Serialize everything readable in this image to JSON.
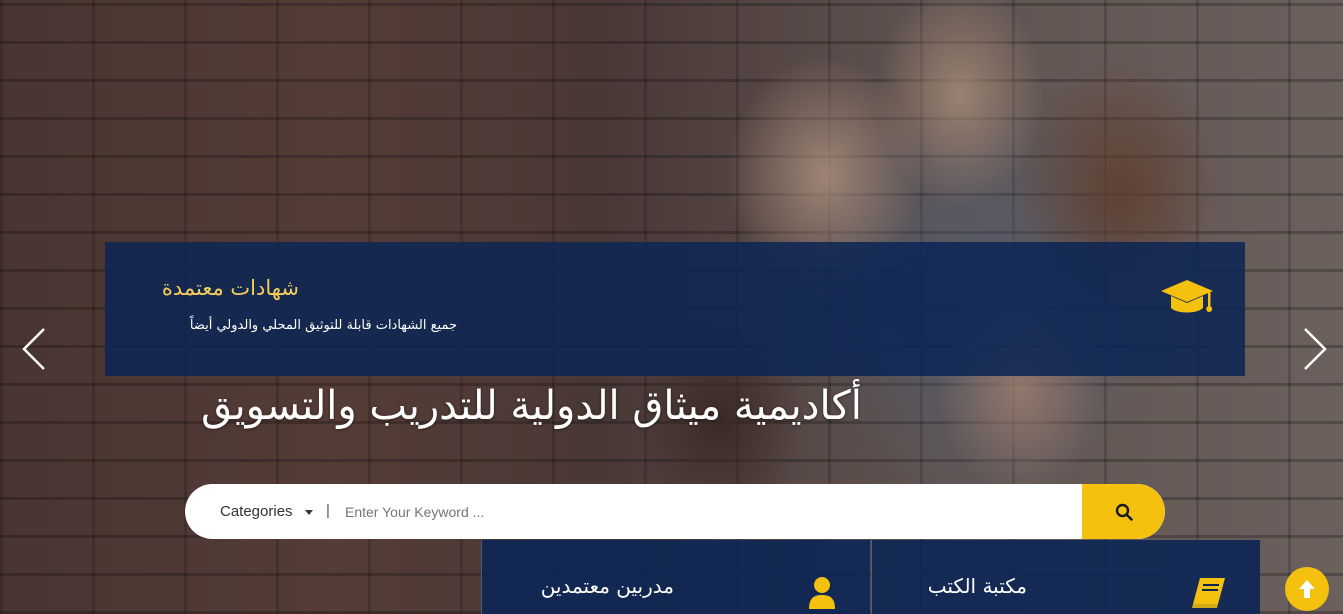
{
  "slider": {
    "caption_title": "شهادات معتمدة",
    "caption_text": "جميع الشهادات قابلة للتوثيق المحلي والدولي أيضاً",
    "caption_icon": "graduation-cap-icon",
    "prev_icon": "chevron-left-icon",
    "next_icon": "chevron-right-icon"
  },
  "headline": "أكاديمية ميثاق الدولية للتدريب والتسويق",
  "search": {
    "category_label": "Categories",
    "separator": "|",
    "keyword_placeholder": "Enter Your Keyword ...",
    "keyword_value": "",
    "button_icon": "search-icon"
  },
  "features": [
    {
      "title": "مدربين معتمدين",
      "icon": "user-icon"
    },
    {
      "title": "مكتبة الكتب",
      "icon": "book-icon"
    }
  ],
  "colors": {
    "accent": "#f4c10f",
    "caption_title": "#f6cc5a",
    "panel": "#0c2654"
  }
}
